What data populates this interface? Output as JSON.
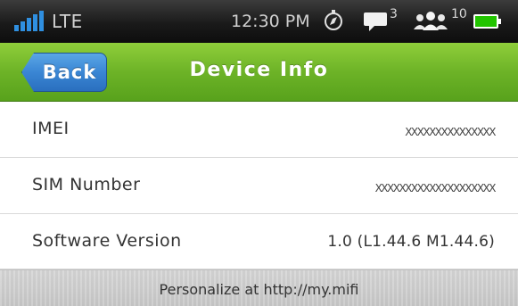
{
  "status_bar": {
    "network": "LTE",
    "time": "12:30 PM",
    "messages_count": "3",
    "connected_users_count": "10",
    "icons": [
      "signal-bars-icon",
      "compass-icon",
      "message-icon",
      "users-icon",
      "battery-icon"
    ],
    "battery_color": "#22c400"
  },
  "nav": {
    "back_label": "Back",
    "title": "Device Info"
  },
  "info": {
    "rows": [
      {
        "label": "IMEI",
        "value": "XXXXXXXXXXXXXXX"
      },
      {
        "label": "SIM Number",
        "value": "XXXXXXXXXXXXXXXXXXXX"
      },
      {
        "label": "Software Version",
        "value": "1.0 (L1.44.6 M1.44.6)"
      }
    ]
  },
  "footer": {
    "text": "Personalize at http://my.mifi"
  },
  "colors": {
    "nav_green": "#6db327",
    "back_blue": "#3a86d4",
    "status_bar": "#1a1a1a"
  }
}
